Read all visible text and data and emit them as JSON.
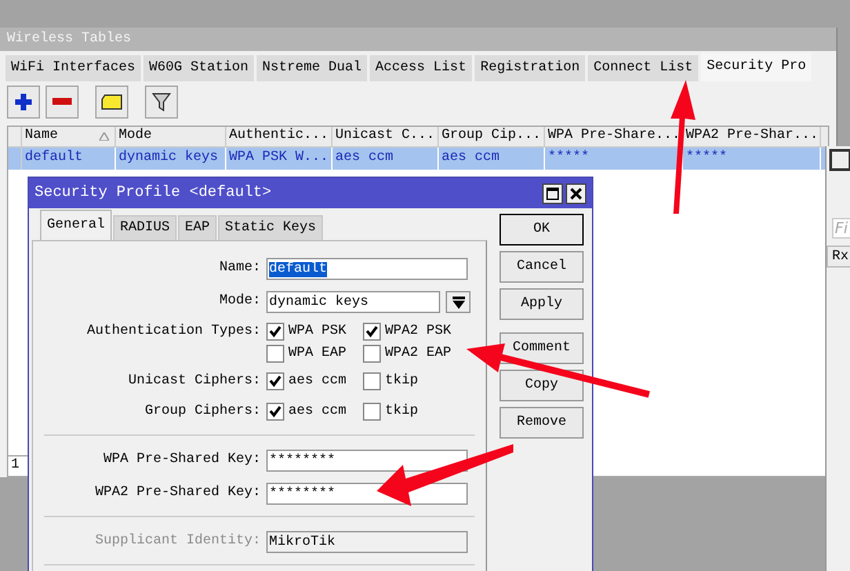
{
  "window": {
    "title": "Wireless Tables"
  },
  "tabs": [
    {
      "label": "WiFi Interfaces",
      "selected": false
    },
    {
      "label": "W60G Station",
      "selected": false
    },
    {
      "label": "Nstreme Dual",
      "selected": false
    },
    {
      "label": "Access List",
      "selected": false
    },
    {
      "label": "Registration",
      "selected": false
    },
    {
      "label": "Connect List",
      "selected": false
    },
    {
      "label": "Security Pro",
      "selected": true
    }
  ],
  "table": {
    "columns": [
      {
        "label": "Name",
        "sorted": true
      },
      {
        "label": "Mode",
        "sorted": false
      },
      {
        "label": "Authentic...",
        "sorted": false
      },
      {
        "label": "Unicast C...",
        "sorted": false
      },
      {
        "label": "Group Cip...",
        "sorted": false
      },
      {
        "label": "WPA Pre-Share...",
        "sorted": false
      },
      {
        "label": "WPA2 Pre-Shar...",
        "sorted": false
      }
    ],
    "rows": [
      {
        "selected": true,
        "cells": [
          "default",
          "dynamic keys",
          "WPA PSK W...",
          "aes ccm",
          "aes ccm",
          "*****",
          "*****"
        ]
      }
    ],
    "status": "1"
  },
  "side_window": {
    "find_placeholder": "Fi",
    "column": "Rx"
  },
  "dialog": {
    "title": "Security Profile <default>",
    "tabs": [
      {
        "label": "General",
        "selected": true
      },
      {
        "label": "RADIUS",
        "selected": false
      },
      {
        "label": "EAP",
        "selected": false
      },
      {
        "label": "Static Keys",
        "selected": false
      }
    ],
    "fields": [
      {
        "kind": "text",
        "label": "Name:",
        "value": "default",
        "highlighted": true,
        "disabled": false
      },
      {
        "kind": "dropdown",
        "label": "Mode:",
        "value": "dynamic keys"
      },
      {
        "kind": "checks",
        "label": "Authentication Types:",
        "options": [
          {
            "label": "WPA PSK",
            "checked": true
          },
          {
            "label": "WPA2 PSK",
            "checked": true
          },
          {
            "label": "WPA EAP",
            "checked": false
          },
          {
            "label": "WPA2 EAP",
            "checked": false
          }
        ]
      },
      {
        "kind": "checks",
        "label": "Unicast Ciphers:",
        "options": [
          {
            "label": "aes ccm",
            "checked": true
          },
          {
            "label": "tkip",
            "checked": false
          }
        ]
      },
      {
        "kind": "checks",
        "label": "Group Ciphers:",
        "options": [
          {
            "label": "aes ccm",
            "checked": true
          },
          {
            "label": "tkip",
            "checked": false
          }
        ]
      },
      {
        "kind": "separator"
      },
      {
        "kind": "text",
        "label": "WPA Pre-Shared Key:",
        "value": "********",
        "highlighted": false,
        "disabled": false
      },
      {
        "kind": "text",
        "label": "WPA2 Pre-Shared Key:",
        "value": "********",
        "highlighted": false,
        "disabled": false
      },
      {
        "kind": "separator"
      },
      {
        "kind": "text",
        "label": "Supplicant Identity:",
        "value": "MikroTik",
        "highlighted": false,
        "disabled": true
      },
      {
        "kind": "separator"
      }
    ],
    "buttons": [
      {
        "label": "OK",
        "default": true
      },
      {
        "label": "Cancel",
        "default": false
      },
      {
        "label": "Apply",
        "default": false
      },
      {
        "label": "Comment",
        "default": false
      },
      {
        "label": "Copy",
        "default": false
      },
      {
        "label": "Remove",
        "default": false
      }
    ]
  }
}
